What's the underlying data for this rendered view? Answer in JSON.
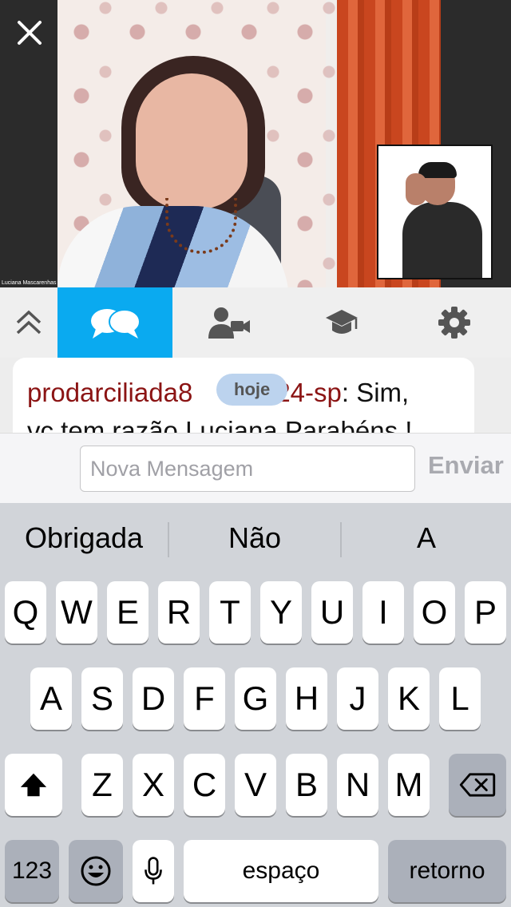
{
  "video": {
    "speaker_name_tag": "Luciana Mascarenhas"
  },
  "icons": {
    "close": "close-icon",
    "collapse": "double-chevron-up-icon",
    "chat": "chat-bubbles-icon",
    "camera": "person-camera-icon",
    "courses": "graduation-cap-icon",
    "settings": "gear-icon"
  },
  "colors": {
    "tab_active": "#0aaaf0",
    "username": "#8b1414",
    "date_pill": "#bcd3ee"
  },
  "chat": {
    "message": {
      "user": "prodarciliada8",
      "user_tail": "24-sp",
      "text": ": Sim,",
      "line2": "vc tem razão Luciana Parabéns !"
    },
    "date_pill": "hoje"
  },
  "composer": {
    "placeholder": "Nova Mensagem",
    "value": "",
    "send_label": "Enviar"
  },
  "keyboard": {
    "suggestions": [
      "Obrigada",
      "Não",
      "A"
    ],
    "row1": [
      "Q",
      "W",
      "E",
      "R",
      "T",
      "Y",
      "U",
      "I",
      "O",
      "P"
    ],
    "row2": [
      "A",
      "S",
      "D",
      "F",
      "G",
      "H",
      "J",
      "K",
      "L"
    ],
    "row3": [
      "Z",
      "X",
      "C",
      "V",
      "B",
      "N",
      "M"
    ],
    "numbers_label": "123",
    "space_label": "espaço",
    "return_label": "retorno"
  }
}
